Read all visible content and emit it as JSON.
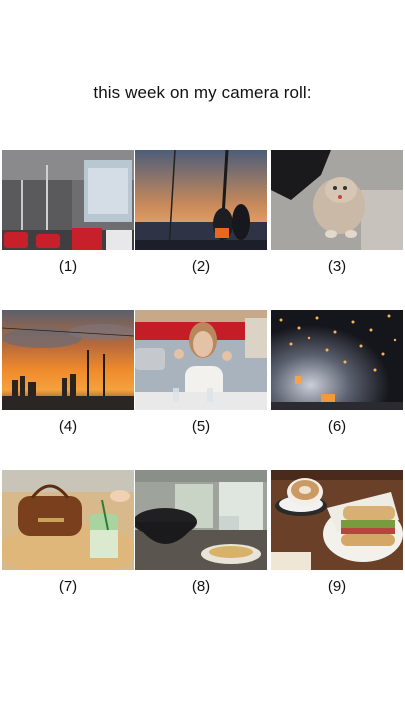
{
  "title": "this week on my camera roll:",
  "photos": [
    {
      "caption": "(1)",
      "subject": "bus interior with red seats"
    },
    {
      "caption": "(2)",
      "subject": "sunset on a boat"
    },
    {
      "caption": "(3)",
      "subject": "cat being petted"
    },
    {
      "caption": "(4)",
      "subject": "orange sunset over city skyline"
    },
    {
      "caption": "(5)",
      "subject": "woman at cafe with red awning"
    },
    {
      "caption": "(6)",
      "subject": "sky lanterns at night"
    },
    {
      "caption": "(7)",
      "subject": "leather bag and iced matcha"
    },
    {
      "caption": "(8)",
      "subject": "cafe table with bowl"
    },
    {
      "caption": "(9)",
      "subject": "latte and sandwich"
    }
  ]
}
